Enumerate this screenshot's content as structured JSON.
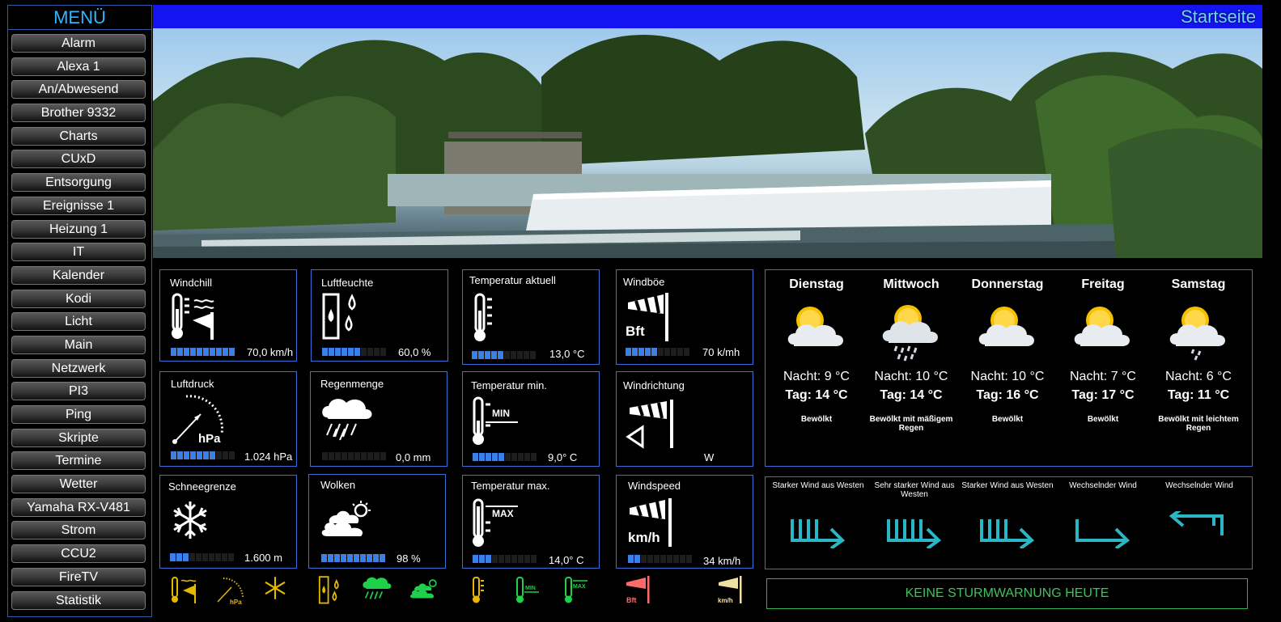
{
  "menu": {
    "title": "MENÜ",
    "items": [
      "Alarm",
      "Alexa 1",
      "An/Abwesend",
      "Brother 9332",
      "Charts",
      "CUxD",
      "Entsorgung",
      "Ereignisse 1",
      "Heizung 1",
      "IT",
      "Kalender",
      "Kodi",
      "Licht",
      "Main",
      "Netzwerk",
      "PI3",
      "Ping",
      "Skripte",
      "Termine",
      "Wetter",
      "Yamaha RX-V481",
      "Strom",
      "CCU2",
      "FireTV",
      "Statistik"
    ]
  },
  "header": {
    "title": "Startseite"
  },
  "tiles": {
    "windchill": {
      "label": "Windchill",
      "value": "70,0 km/h",
      "level": 10,
      "of": 10
    },
    "luftfeuchte": {
      "label": "Luftfeuchte",
      "value": "60,0 %",
      "level": 6,
      "of": 10
    },
    "temp_aktuell": {
      "label": "Temperatur aktuell",
      "value": "13,0 °C",
      "level": 5,
      "of": 10
    },
    "windboe": {
      "label": "Windböe",
      "value": "70 k/mh",
      "level": 5,
      "of": 10,
      "icon_text": "Bft"
    },
    "luftdruck": {
      "label": "Luftdruck",
      "value": "1.024 hPa",
      "level": 7,
      "of": 10,
      "icon_text": "hPa"
    },
    "regenmenge": {
      "label": "Regenmenge",
      "value": "0,0 mm",
      "level": 0,
      "of": 10
    },
    "temp_min": {
      "label": "Temperatur min.",
      "value": "9,0° C",
      "level": 5,
      "of": 10,
      "icon_text": "MIN"
    },
    "windrichtung": {
      "label": "Windrichtung",
      "value": "W"
    },
    "schneegrenze": {
      "label": "Schneegrenze",
      "value": "1.600 m",
      "level": 3,
      "of": 10
    },
    "wolken": {
      "label": "Wolken",
      "value": "98 %",
      "level": 10,
      "of": 10
    },
    "temp_max": {
      "label": "Temperatur max.",
      "value": "14,0° C",
      "level": 3,
      "of": 10,
      "icon_text": "MAX"
    },
    "windspeed": {
      "label": "Windspeed",
      "value": "34 km/h",
      "level": 2,
      "of": 10,
      "icon_text": "km/h"
    }
  },
  "forecast": [
    {
      "day": "Dienstag",
      "night": "Nacht: 9 °C",
      "daytemp": "Tag: 14 °C",
      "desc": "Bewölkt",
      "icon": "partly-cloudy-icon"
    },
    {
      "day": "Mittwoch",
      "night": "Nacht: 10 °C",
      "daytemp": "Tag: 14 °C",
      "desc": "Bewölkt mit mäßigem Regen",
      "icon": "cloud-rain-icon"
    },
    {
      "day": "Donnerstag",
      "night": "Nacht: 10 °C",
      "daytemp": "Tag: 16 °C",
      "desc": "Bewölkt",
      "icon": "partly-cloudy-icon"
    },
    {
      "day": "Freitag",
      "night": "Nacht: 7 °C",
      "daytemp": "Tag: 17 °C",
      "desc": "Bewölkt",
      "icon": "partly-cloudy-icon"
    },
    {
      "day": "Samstag",
      "night": "Nacht: 6 °C",
      "daytemp": "Tag: 11 °C",
      "desc": "Bewölkt mit leichtem Regen",
      "icon": "cloud-light-rain-icon"
    }
  ],
  "wind": [
    {
      "text": "Starker Wind aus Westen",
      "icon": "wind-east-arrow-icon"
    },
    {
      "text": "Sehr starker Wind aus Westen",
      "icon": "wind-east-arrow-icon"
    },
    {
      "text": "Starker Wind aus Westen",
      "icon": "wind-east-arrow-icon"
    },
    {
      "text": "Wechselnder Wind",
      "icon": "wind-east-arrow-icon"
    },
    {
      "text": "Wechselnder Wind",
      "icon": "wind-west-arrow-icon"
    }
  ],
  "storm": {
    "text": "KEINE STURMWARNUNG HEUTE"
  },
  "colors": {
    "header": "#1414f0",
    "accent": "#33b5ff",
    "tile_border": "#3a6fd8",
    "bar": "#3b7fe8",
    "storm": "#3fc35a",
    "wind_icon": "#2bb6c6"
  }
}
